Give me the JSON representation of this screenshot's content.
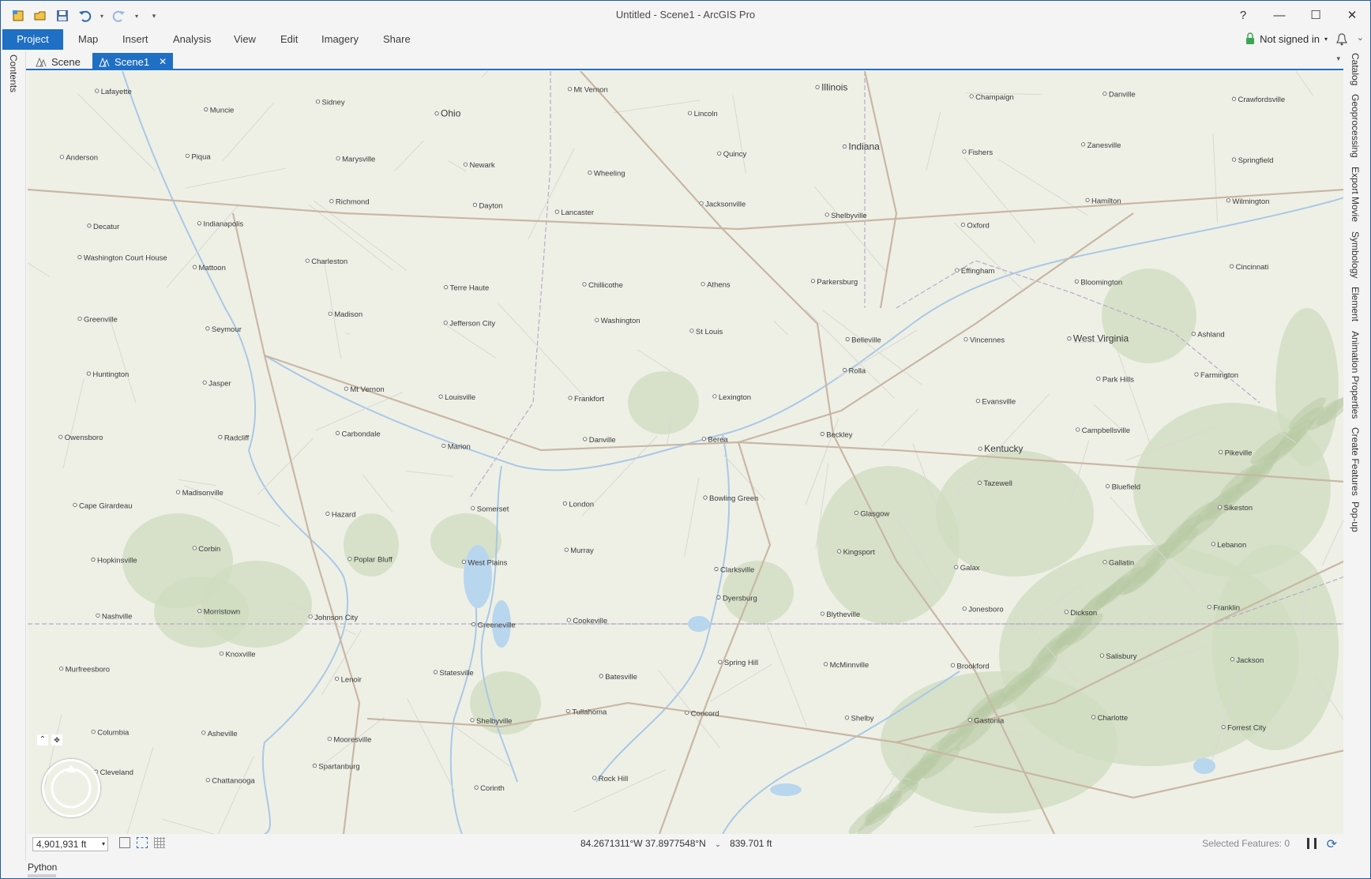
{
  "window": {
    "title": "Untitled - Scene1 - ArcGIS Pro",
    "help_label": "?",
    "minimize_label": "—",
    "maximize_label": "☐",
    "close_label": "✕"
  },
  "ribbon": {
    "tabs": [
      {
        "label": "Project",
        "active": true
      },
      {
        "label": "Map"
      },
      {
        "label": "Insert"
      },
      {
        "label": "Analysis"
      },
      {
        "label": "View"
      },
      {
        "label": "Edit"
      },
      {
        "label": "Imagery"
      },
      {
        "label": "Share"
      }
    ],
    "account_label": "Not signed in"
  },
  "left_panel": {
    "label": "Contents"
  },
  "right_panels": [
    "Catalog",
    "Geoprocessing",
    "Export Movie",
    "Symbology",
    "Element",
    "Animation Properties",
    "Create Features",
    "Pop-up"
  ],
  "view_tabs": [
    {
      "label": "Scene",
      "active": false
    },
    {
      "label": "Scene1",
      "active": true
    }
  ],
  "map": {
    "cities": [
      {
        "name": "Lafayette"
      },
      {
        "name": "Muncie"
      },
      {
        "name": "Sidney"
      },
      {
        "name": "Ohio"
      },
      {
        "name": "Mt Vernon"
      },
      {
        "name": "Lincoln"
      },
      {
        "name": "Illinois"
      },
      {
        "name": "Champaign"
      },
      {
        "name": "Danville"
      },
      {
        "name": "Crawfordsville"
      },
      {
        "name": "Anderson"
      },
      {
        "name": "Piqua"
      },
      {
        "name": "Marysville"
      },
      {
        "name": "Newark"
      },
      {
        "name": "Wheeling"
      },
      {
        "name": "Quincy"
      },
      {
        "name": "Indiana"
      },
      {
        "name": "Fishers"
      },
      {
        "name": "Zanesville"
      },
      {
        "name": "Springfield"
      },
      {
        "name": "Decatur"
      },
      {
        "name": "Indianapolis"
      },
      {
        "name": "Richmond"
      },
      {
        "name": "Dayton"
      },
      {
        "name": "Lancaster"
      },
      {
        "name": "Jacksonville"
      },
      {
        "name": "Shelbyville"
      },
      {
        "name": "Oxford"
      },
      {
        "name": "Hamilton"
      },
      {
        "name": "Wilmington"
      },
      {
        "name": "Washington Court House"
      },
      {
        "name": "Mattoon"
      },
      {
        "name": "Charleston"
      },
      {
        "name": "Terre Haute"
      },
      {
        "name": "Chillicothe"
      },
      {
        "name": "Athens"
      },
      {
        "name": "Parkersburg"
      },
      {
        "name": "Effingham"
      },
      {
        "name": "Bloomington"
      },
      {
        "name": "Cincinnati"
      },
      {
        "name": "Greenville"
      },
      {
        "name": "Seymour"
      },
      {
        "name": "Madison"
      },
      {
        "name": "Jefferson City"
      },
      {
        "name": "Washington"
      },
      {
        "name": "St Louis"
      },
      {
        "name": "Belleville"
      },
      {
        "name": "Vincennes"
      },
      {
        "name": "West Virginia"
      },
      {
        "name": "Ashland"
      },
      {
        "name": "Huntington"
      },
      {
        "name": "Jasper"
      },
      {
        "name": "Mt Vernon"
      },
      {
        "name": "Louisville"
      },
      {
        "name": "Frankfort"
      },
      {
        "name": "Lexington"
      },
      {
        "name": "Rolla"
      },
      {
        "name": "Evansville"
      },
      {
        "name": "Park Hills"
      },
      {
        "name": "Farmington"
      },
      {
        "name": "Owensboro"
      },
      {
        "name": "Radcliff"
      },
      {
        "name": "Carbondale"
      },
      {
        "name": "Marion"
      },
      {
        "name": "Danville"
      },
      {
        "name": "Berea"
      },
      {
        "name": "Beckley"
      },
      {
        "name": "Kentucky"
      },
      {
        "name": "Campbellsville"
      },
      {
        "name": "Pikeville"
      },
      {
        "name": "Cape Girardeau"
      },
      {
        "name": "Madisonville"
      },
      {
        "name": "Hazard"
      },
      {
        "name": "Somerset"
      },
      {
        "name": "London"
      },
      {
        "name": "Bowling Green"
      },
      {
        "name": "Glasgow"
      },
      {
        "name": "Tazewell"
      },
      {
        "name": "Bluefield"
      },
      {
        "name": "Sikeston"
      },
      {
        "name": "Hopkinsville"
      },
      {
        "name": "Corbin"
      },
      {
        "name": "Poplar Bluff"
      },
      {
        "name": "West Plains"
      },
      {
        "name": "Murray"
      },
      {
        "name": "Clarksville"
      },
      {
        "name": "Kingsport"
      },
      {
        "name": "Galax"
      },
      {
        "name": "Gallatin"
      },
      {
        "name": "Lebanon"
      },
      {
        "name": "Nashville"
      },
      {
        "name": "Morristown"
      },
      {
        "name": "Johnson City"
      },
      {
        "name": "Greeneville"
      },
      {
        "name": "Cookeville"
      },
      {
        "name": "Dyersburg"
      },
      {
        "name": "Blytheville"
      },
      {
        "name": "Jonesboro"
      },
      {
        "name": "Dickson"
      },
      {
        "name": "Franklin"
      },
      {
        "name": "Murfreesboro"
      },
      {
        "name": "Knoxville"
      },
      {
        "name": "Lenoir"
      },
      {
        "name": "Statesville"
      },
      {
        "name": "Batesville"
      },
      {
        "name": "Spring Hill"
      },
      {
        "name": "McMinnville"
      },
      {
        "name": "Brookford"
      },
      {
        "name": "Salisbury"
      },
      {
        "name": "Jackson"
      },
      {
        "name": "Columbia"
      },
      {
        "name": "Asheville"
      },
      {
        "name": "Mooresville"
      },
      {
        "name": "Shelbyville"
      },
      {
        "name": "Tullahoma"
      },
      {
        "name": "Concord"
      },
      {
        "name": "Shelby"
      },
      {
        "name": "Gastonia"
      },
      {
        "name": "Charlotte"
      },
      {
        "name": "Forrest City"
      },
      {
        "name": "Cleveland"
      },
      {
        "name": "Chattanooga"
      },
      {
        "name": "Spartanburg"
      },
      {
        "name": "Corinth"
      },
      {
        "name": "Rock Hill"
      }
    ]
  },
  "status": {
    "scale_value": "4,901,931 ft",
    "coordinates": "84.2671311°W 37.8977548°N",
    "elevation": "839.701 ft",
    "selected_features": "Selected Features: 0"
  },
  "bottom": {
    "python_tab": "Python"
  }
}
